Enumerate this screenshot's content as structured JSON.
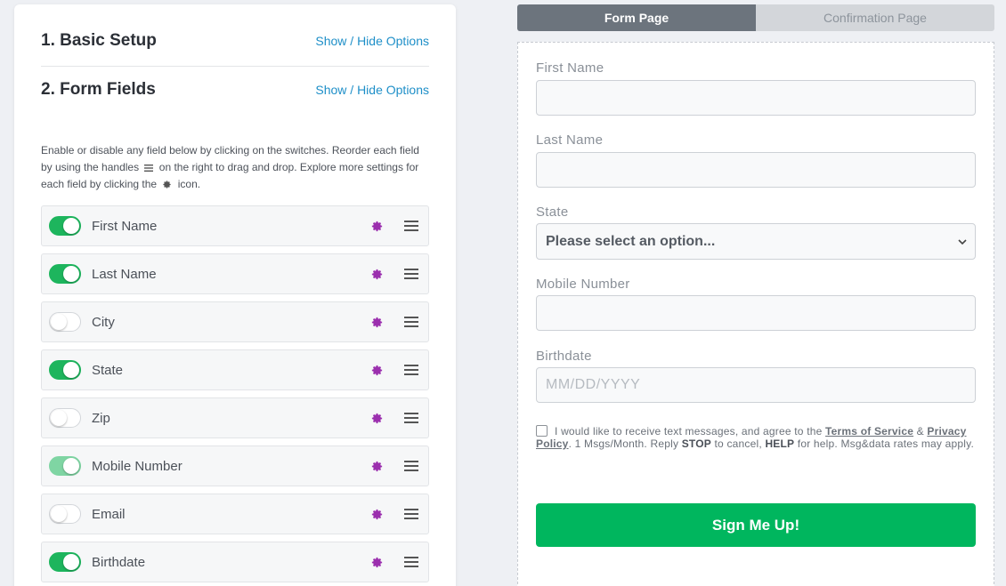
{
  "builder": {
    "sections": [
      {
        "title": "1. Basic Setup",
        "link": "Show / Hide Options"
      },
      {
        "title": "2. Form Fields",
        "link": "Show / Hide Options"
      }
    ],
    "instructions": {
      "part1": "Enable or disable any field below by clicking on the switches. Reorder each field by using the handles",
      "part2": "on the right to drag and drop. Explore more settings for each field by clicking the",
      "part3": "icon."
    },
    "fields": [
      {
        "label": "First Name",
        "enabled": true
      },
      {
        "label": "Last Name",
        "enabled": true
      },
      {
        "label": "City",
        "enabled": false
      },
      {
        "label": "State",
        "enabled": true
      },
      {
        "label": "Zip",
        "enabled": false
      },
      {
        "label": "Mobile Number",
        "enabled": true
      },
      {
        "label": "Email",
        "enabled": false
      },
      {
        "label": "Birthdate",
        "enabled": true
      }
    ]
  },
  "tabs": {
    "form_page": "Form Page",
    "confirmation_page": "Confirmation Page"
  },
  "form": {
    "first_name_label": "First Name",
    "last_name_label": "Last Name",
    "state_label": "State",
    "state_placeholder": "Please select an option...",
    "mobile_label": "Mobile Number",
    "birthdate_label": "Birthdate",
    "birthdate_placeholder": "MM/DD/YYYY",
    "consent": {
      "text1": "I would like to receive text messages, and agree to the",
      "terms": "Terms of Service",
      "amp": "&",
      "privacy": "Privacy Policy",
      "text2": ". 1 Msgs/Month. Reply",
      "stop": "STOP",
      "text3": "to cancel,",
      "help": "HELP",
      "text4": "for help. Msg&data rates may apply."
    },
    "submit": "Sign Me Up!"
  },
  "colors": {
    "accent_green": "#00b65e",
    "toggle_on": "#1db55d",
    "link_blue": "#1e8fc8",
    "gear_purple": "#9b2fae"
  }
}
